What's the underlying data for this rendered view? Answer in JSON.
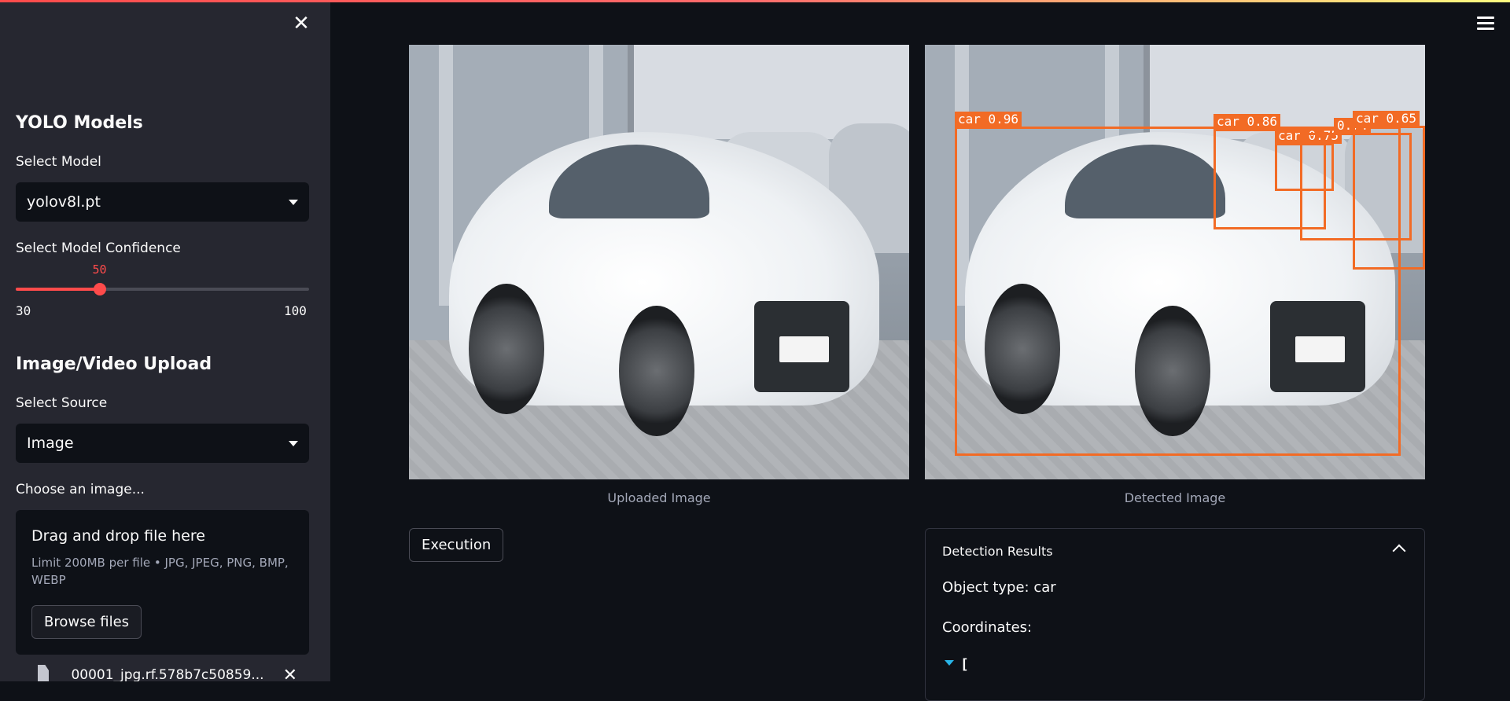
{
  "sidebar": {
    "close_icon": "close-icon",
    "models_title": "YOLO Models",
    "select_model_label": "Select Model",
    "model_value": "yolov8l.pt",
    "confidence_label": "Select Model Confidence",
    "confidence": {
      "value": "50",
      "min": "30",
      "max": "100"
    },
    "upload_title": "Image/Video Upload",
    "source_label": "Select Source",
    "source_value": "Image",
    "choose_label": "Choose an image...",
    "uploader": {
      "drag_title": "Drag and drop file here",
      "limit": "Limit 200MB per file • JPG, JPEG, PNG, BMP, WEBP",
      "browse_label": "Browse files"
    },
    "file_name": "00001_jpg.rf.578b7c50859..."
  },
  "main": {
    "uploaded_caption": "Uploaded Image",
    "detected_caption": "Detected Image",
    "execution_label": "Execution",
    "detections": [
      {
        "label": "car 0.96"
      },
      {
        "label": "car 0.86"
      },
      {
        "label": "car 0.75"
      },
      {
        "label": "0.74"
      },
      {
        "label": "car 0.65"
      }
    ],
    "results": {
      "title": "Detection Results",
      "object_type": "Object type: car",
      "coordinates_label": "Coordinates:",
      "json_open": "["
    }
  },
  "colors": {
    "accent": "#ff4b4b",
    "bbox": "#f26b25",
    "sidebar_bg": "#262730",
    "main_bg": "#0e1117"
  }
}
